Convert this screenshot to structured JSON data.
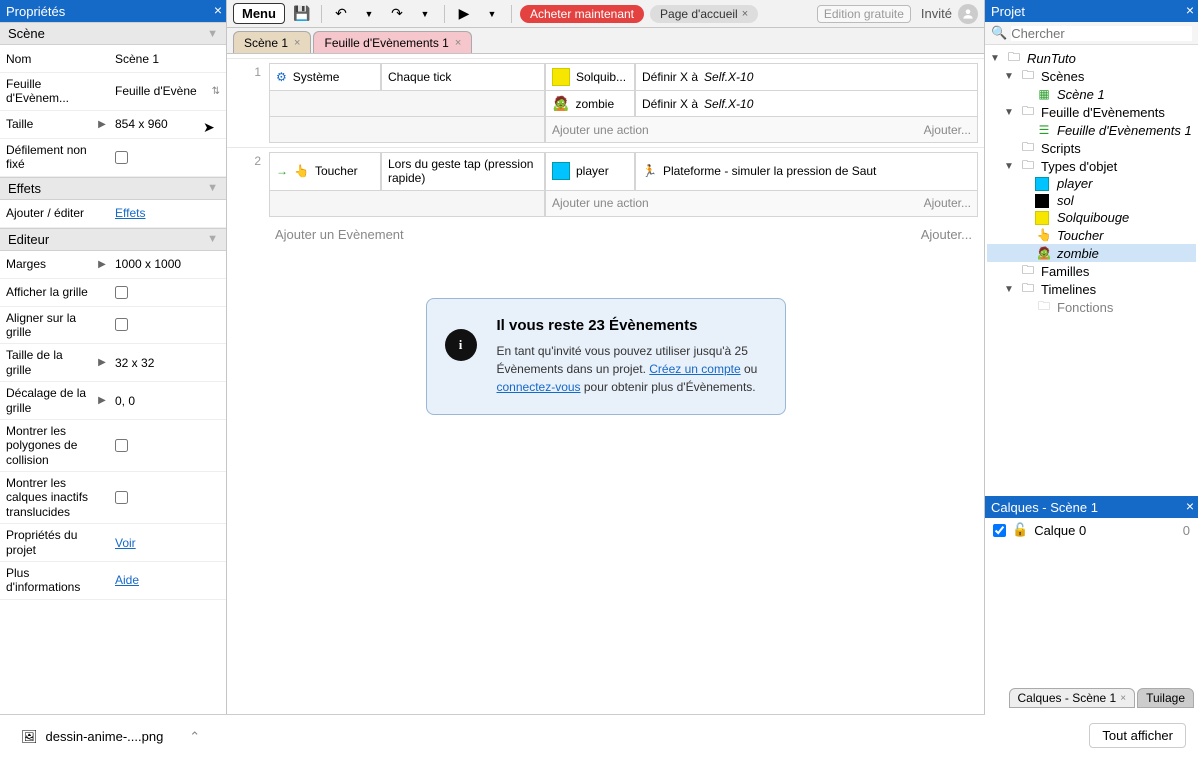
{
  "panels": {
    "props_title": "Propriétés",
    "project_title": "Projet",
    "layers_title": "Calques - Scène 1"
  },
  "props": {
    "scene_group": "Scène",
    "name_label": "Nom",
    "name_value": "Scène 1",
    "eventsheet_label": "Feuille d'Evènem...",
    "eventsheet_value": "Feuille d'Evène",
    "size_label": "Taille",
    "size_value": "854 x 960",
    "unboundscroll_label": "Défilement non fixé",
    "effects_group": "Effets",
    "addedit_label": "Ajouter / éditer",
    "effects_link": "Effets",
    "editor_group": "Editeur",
    "margins_label": "Marges",
    "margins_value": "1000 x 1000",
    "showgrid_label": "Afficher la grille",
    "snapgrid_label": "Aligner sur la grille",
    "gridsize_label": "Taille de la grille",
    "gridsize_value": "32 x 32",
    "gridoffset_label": "Décalage de la grille",
    "gridoffset_value": "0, 0",
    "showcollision_label": "Montrer les polygones de collision",
    "translucent_label": "Montrer les calques inactifs translucides",
    "projectprops_label": "Propriétés du projet",
    "view_link": "Voir",
    "moreinfo_label": "Plus d'informations",
    "help_link": "Aide"
  },
  "toolbar": {
    "menu": "Menu",
    "buy": "Acheter maintenant",
    "home": "Page d'accueil",
    "edition": "Edition gratuite",
    "guest": "Invité"
  },
  "doctabs": {
    "scene": "Scène 1",
    "eventsheet": "Feuille d'Evènements 1"
  },
  "events": {
    "num1": "1",
    "num2": "2",
    "cond1": "Système",
    "cond1b": "Chaque tick",
    "act1_obj": "Solquib...",
    "act1_txt_a": "Définir X à ",
    "act1_txt_b": "Self.X-10",
    "act2_obj": "zombie",
    "act2_txt_a": "Définir X à ",
    "act2_txt_b": "Self.X-10",
    "addaction": "Ajouter une action",
    "addellipsis": "Ajouter...",
    "cond2": "Toucher",
    "cond2b": "Lors du geste tap (pression rapide)",
    "act3_obj": "player",
    "act3_txt": "Plateforme - simuler la pression de Saut",
    "addevent": "Ajouter un Evènement"
  },
  "info": {
    "title": "Il vous reste 23 Évènements",
    "body1": "En tant qu'invité vous pouvez utiliser jusqu'à 25 Évènements dans un projet. ",
    "link1": "Créez un compte",
    "body2": " ou ",
    "link2": "connectez-vous",
    "body3": " pour obtenir plus d'Évènements."
  },
  "project": {
    "search_placeholder": "Chercher",
    "root": "RunTuto",
    "scenes": "Scènes",
    "scene1": "Scène 1",
    "eventsheets": "Feuille d'Evènements",
    "eventsheet1": "Feuille d'Evènements 1",
    "scripts": "Scripts",
    "objecttypes": "Types d'objet",
    "obj_player": "player",
    "obj_sol": "sol",
    "obj_solquibouge": "Solquibouge",
    "obj_toucher": "Toucher",
    "obj_zombie": "zombie",
    "families": "Familles",
    "timelines": "Timelines",
    "functions": "Fonctions"
  },
  "layers": {
    "layer0": "Calque 0",
    "layer0_count": "0"
  },
  "bottomtabs": {
    "layers": "Calques - Scène 1",
    "tilemap": "Tuilage"
  },
  "download": {
    "filename": "dessin-anime-....png",
    "showall": "Tout afficher"
  }
}
